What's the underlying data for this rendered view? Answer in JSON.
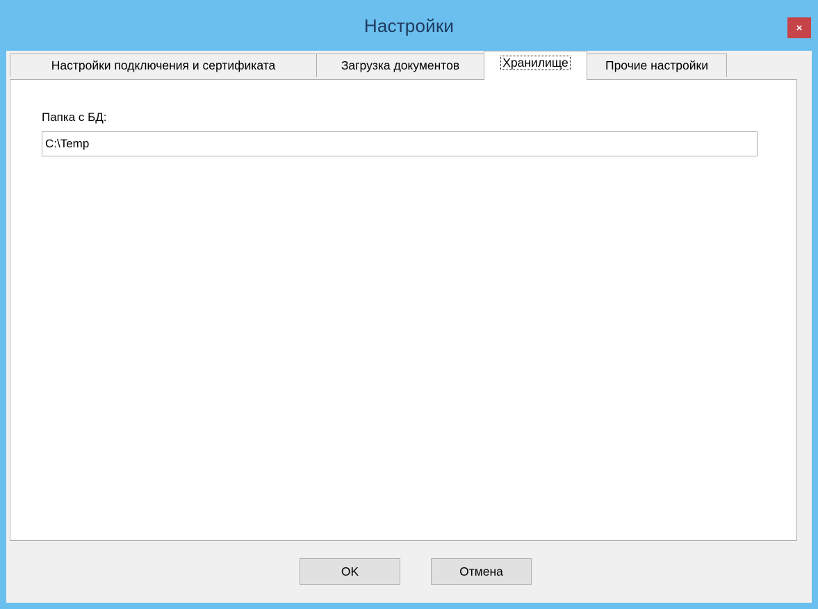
{
  "window": {
    "title": "Настройки",
    "close_label": "×"
  },
  "tabs": [
    {
      "label": "Настройки подключения и сертификата",
      "active": false
    },
    {
      "label": "Загрузка документов",
      "active": false
    },
    {
      "label": "Хранилище",
      "active": true
    },
    {
      "label": "Прочие настройки",
      "active": false
    }
  ],
  "storage": {
    "db_folder_label": "Папка с БД:",
    "db_folder_value": "C:\\Temp"
  },
  "buttons": {
    "ok_label": "OK",
    "cancel_label": "Отмена"
  },
  "colors": {
    "titlebar": "#6bbfee",
    "close_button": "#c7434a",
    "client_background": "#f0f0f0",
    "panel_background": "#ffffff"
  }
}
